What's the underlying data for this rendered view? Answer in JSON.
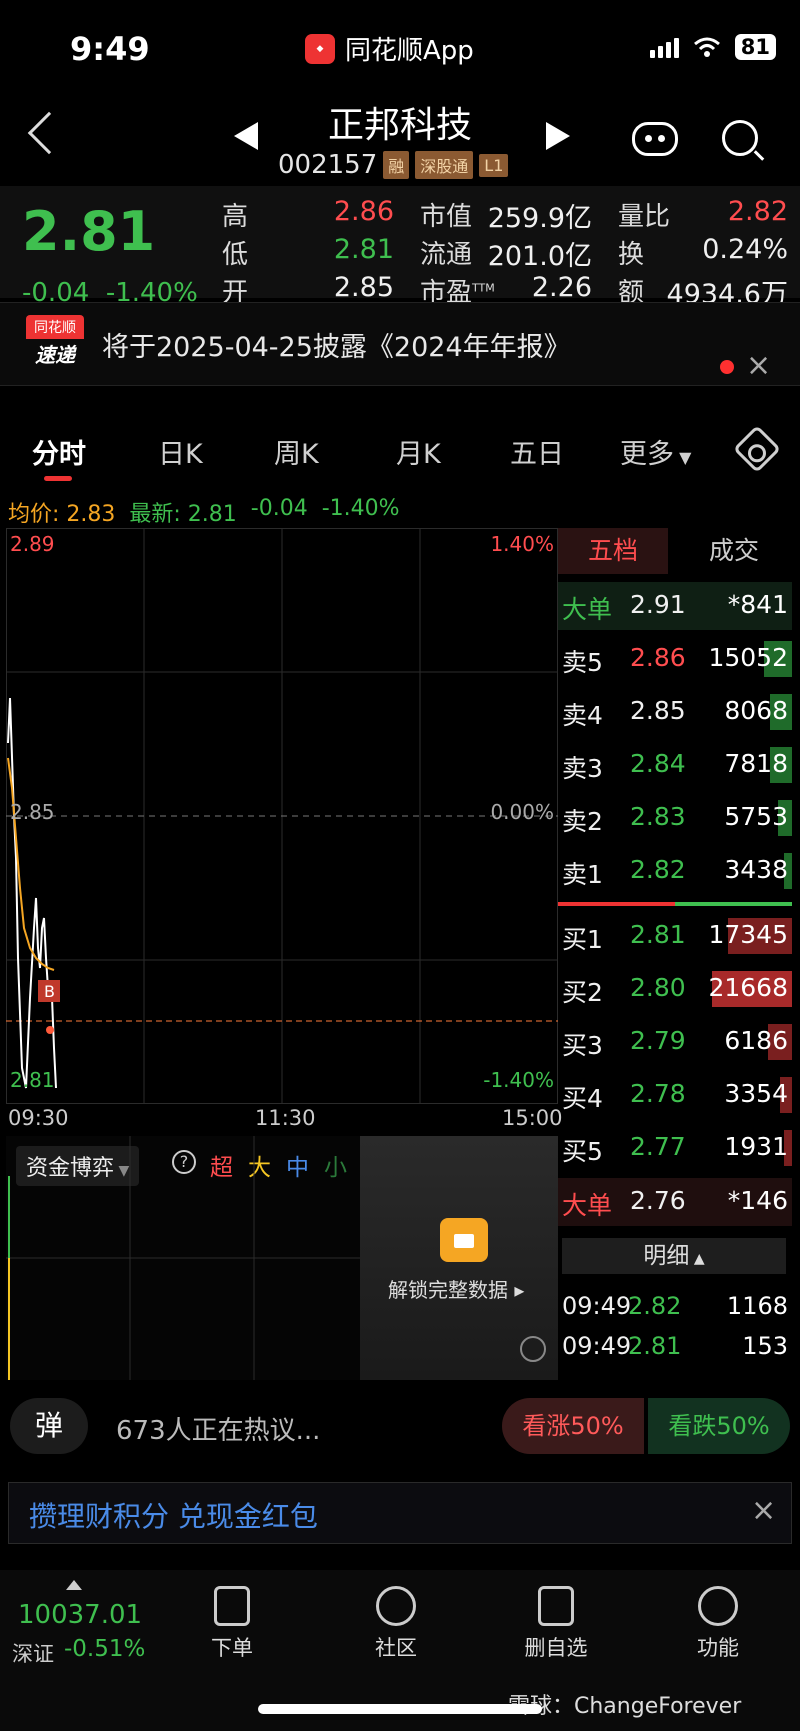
{
  "status_bar": {
    "time": "9:49",
    "app_name": "同花顺App",
    "battery": "81"
  },
  "header": {
    "stock_name": "正邦科技",
    "stock_code": "002157",
    "tags": [
      "融",
      "深股通",
      "L1"
    ]
  },
  "quote": {
    "price": "2.81",
    "change": "-0.04",
    "change_pct": "-1.40%",
    "labels": {
      "high": "高",
      "low": "低",
      "open": "开",
      "mkt_cap": "市值",
      "float": "流通",
      "pe": "市盈",
      "pe_sup": "TTM",
      "vol_ratio": "量比",
      "turnover": "换",
      "amount": "额"
    },
    "high": "2.86",
    "low": "2.81",
    "open": "2.85",
    "mkt_cap": "259.9亿",
    "float": "201.0亿",
    "pe": "2.26",
    "vol_ratio": "2.82",
    "turnover": "0.24%",
    "amount": "4934.6万"
  },
  "news": {
    "logo_top": "同花顺",
    "logo_bottom": "速递",
    "text": "将于2025-04-25披露《2024年年报》",
    "close": "×"
  },
  "tabs": [
    "分时",
    "日K",
    "周K",
    "月K",
    "五日",
    "更多"
  ],
  "avg_row": {
    "avg_label": "均价: 2.83",
    "latest_label": "最新: 2.81",
    "change": "-0.04",
    "change_pct": "-1.40%"
  },
  "chart": {
    "y_top": "2.89",
    "y_mid": "2.85",
    "y_bot": "2.81",
    "pct_top": "1.40%",
    "pct_mid": "0.00%",
    "pct_bot": "-1.40%",
    "x_labels": [
      "09:30",
      "11:30",
      "15:00"
    ],
    "marker": "B"
  },
  "orderbook": {
    "tab_active": "五档",
    "tab_other": "成交",
    "top_big": {
      "label": "大单",
      "price": "2.91",
      "vol": "*841"
    },
    "asks": [
      {
        "label": "卖5",
        "price": "2.86",
        "vol": "15052"
      },
      {
        "label": "卖4",
        "price": "2.85",
        "vol": "8068"
      },
      {
        "label": "卖3",
        "price": "2.84",
        "vol": "7818"
      },
      {
        "label": "卖2",
        "price": "2.83",
        "vol": "5753"
      },
      {
        "label": "卖1",
        "price": "2.82",
        "vol": "3438"
      }
    ],
    "bids": [
      {
        "label": "买1",
        "price": "2.81",
        "vol": "17345"
      },
      {
        "label": "买2",
        "price": "2.80",
        "vol": "21668"
      },
      {
        "label": "买3",
        "price": "2.79",
        "vol": "6186"
      },
      {
        "label": "买4",
        "price": "2.78",
        "vol": "3354"
      },
      {
        "label": "买5",
        "price": "2.77",
        "vol": "1931"
      }
    ],
    "bottom_big": {
      "label": "大单",
      "price": "2.76",
      "vol": "*146"
    },
    "detail_label": "明细",
    "ticks": [
      {
        "time": "09:49",
        "price": "2.82",
        "vol": "1168"
      },
      {
        "time": "09:49",
        "price": "2.81",
        "vol": "153"
      }
    ]
  },
  "flow": {
    "select": "资金博弈",
    "help": "?",
    "cats": [
      "超",
      "大",
      "中",
      "小"
    ],
    "unlock": "解锁完整数据"
  },
  "hot": {
    "danmu": "弹",
    "text": "673人正在热议...",
    "bull": "看涨50%",
    "bear": "看跌50%"
  },
  "promo": {
    "text": "攒理财积分 兑现金红包",
    "close": "×"
  },
  "bottom": {
    "index_value": "10037.01",
    "index_name": "深证",
    "index_change": "-0.51%",
    "nav": [
      "下单",
      "社区",
      "删自选",
      "功能"
    ],
    "watermark": "雪球：ChangeForever"
  }
}
